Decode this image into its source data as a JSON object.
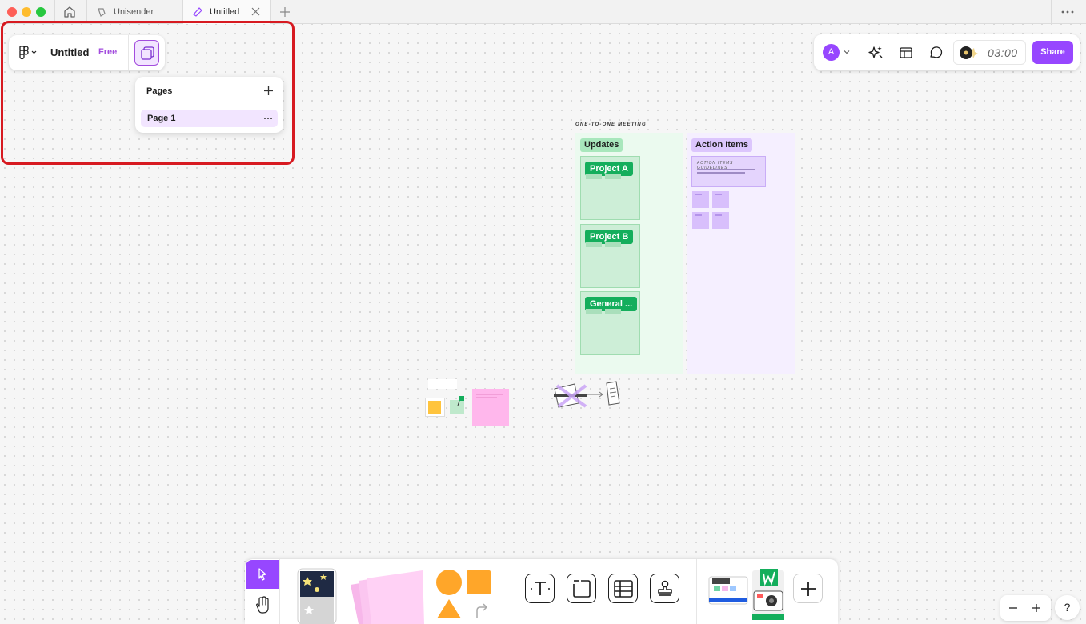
{
  "browser": {
    "tabs": [
      {
        "label": "Unisender"
      },
      {
        "label": "Untitled",
        "active": true
      }
    ]
  },
  "file": {
    "title": "Untitled",
    "plan": "Free"
  },
  "pages_panel": {
    "title": "Pages",
    "pages": [
      {
        "label": "Page 1",
        "selected": true
      }
    ]
  },
  "toolbar": {
    "avatar_initial": "A",
    "timer": "03:00",
    "share_label": "Share"
  },
  "board": {
    "title": "ONE-TO-ONE MEETING",
    "updates": {
      "label": "Updates",
      "topics": [
        "Project A",
        "Project B",
        "General ..."
      ]
    },
    "action_items": {
      "label": "Action Items",
      "guidelines_title": "ACTION ITEMS GUIDELINES"
    }
  },
  "bottom_toolbar": {
    "tools": [
      "move-tool",
      "hand-tool",
      "sticky-notes",
      "shapes",
      "text",
      "section",
      "table",
      "stamp",
      "templates",
      "more"
    ]
  },
  "help": "?",
  "colors": {
    "accent": "#9747ff",
    "highlight": "#d71a21",
    "updates_bg": "#ebfaef",
    "actions_bg": "#f5efff",
    "topic_green": "#14ae5c"
  }
}
